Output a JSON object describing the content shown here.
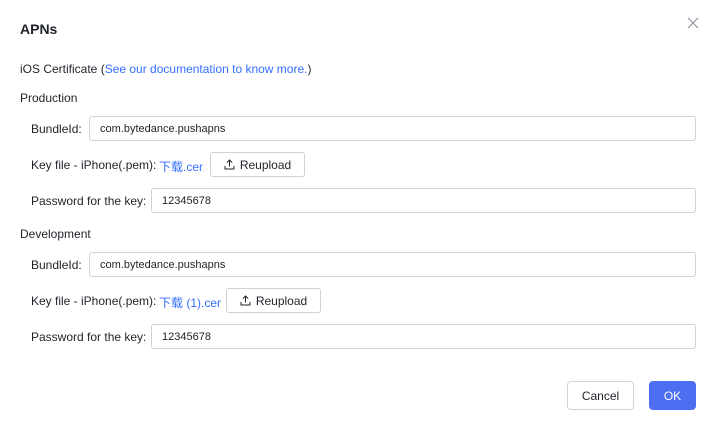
{
  "dialog": {
    "title": "APNs",
    "close_icon": "close-icon",
    "certificate": {
      "label_prefix": "iOS Certificate (",
      "doc_link": "See our documentation to know more.",
      "label_suffix": ")"
    },
    "production": {
      "section_label": "Production",
      "bundle_id_label": "BundleId:",
      "bundle_id_value": "com.bytedance.pushapns",
      "key_file_label": "Key file - iPhone(.pem):",
      "key_file_name": "下载.cer",
      "reupload_label": "Reupload",
      "password_label": "Password for the key:",
      "password_value": "12345678"
    },
    "development": {
      "section_label": "Development",
      "bundle_id_label": "BundleId:",
      "bundle_id_value": "com.bytedance.pushapns",
      "key_file_label": "Key file - iPhone(.pem):",
      "key_file_name": "下载 (1).cer",
      "reupload_label": "Reupload",
      "password_label": "Password for the key:",
      "password_value": "12345678"
    },
    "footer": {
      "cancel_label": "Cancel",
      "ok_label": "OK"
    },
    "colors": {
      "link": "#3370ff",
      "primary": "#4e6ef2",
      "border": "#d0d3d6"
    }
  }
}
